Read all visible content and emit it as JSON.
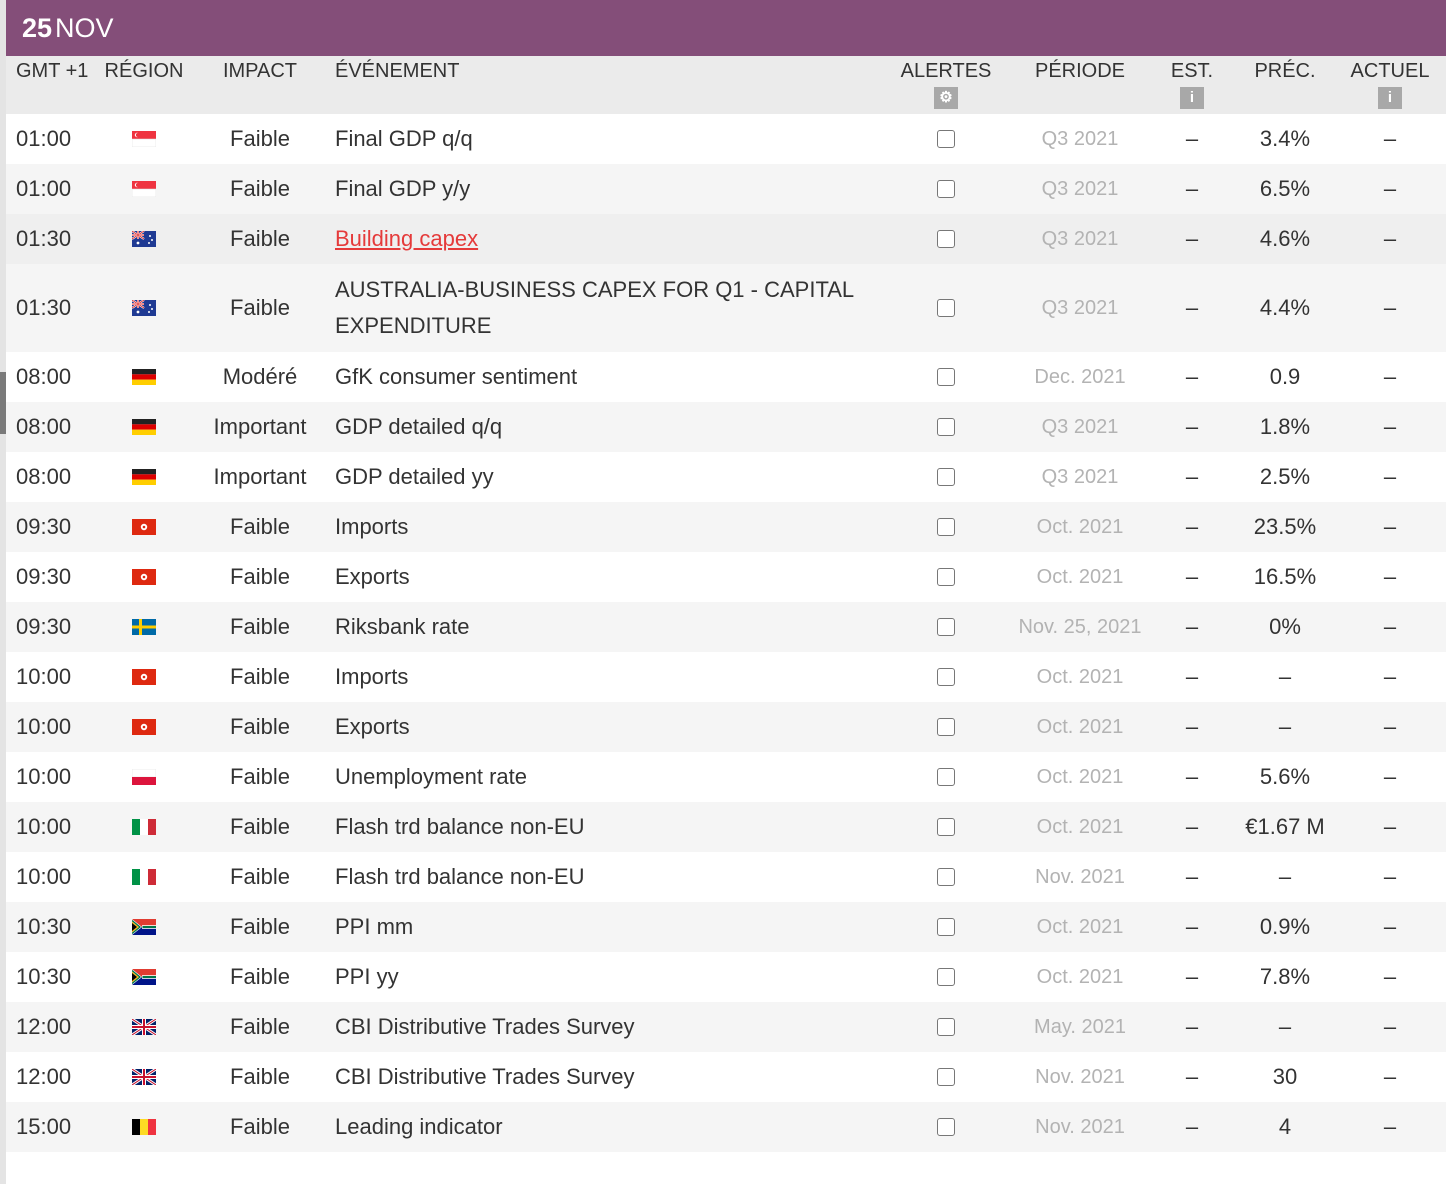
{
  "date": {
    "day": "25",
    "month": "NOV"
  },
  "columns": {
    "gmt": "GMT +1",
    "region": "RÉGION",
    "impact": "IMPACT",
    "event": "ÉVÉNEMENT",
    "alerts": "ALERTES",
    "period": "PÉRIODE",
    "est": "EST.",
    "prec": "PRÉC.",
    "actual": "ACTUEL",
    "alerts_icon": "gear-icon",
    "info_icon": "info-icon"
  },
  "rows": [
    {
      "time": "01:00",
      "flag": "singapore",
      "impact": "Faible",
      "event": "Final GDP q/q",
      "period": "Q3 2021",
      "est": "–",
      "prec": "3.4%",
      "actual": "–"
    },
    {
      "time": "01:00",
      "flag": "singapore",
      "impact": "Faible",
      "event": "Final GDP y/y",
      "period": "Q3 2021",
      "est": "–",
      "prec": "6.5%",
      "actual": "–"
    },
    {
      "time": "01:30",
      "flag": "australia",
      "impact": "Faible",
      "event": "Building capex",
      "period": "Q3 2021",
      "est": "–",
      "prec": "4.6%",
      "actual": "–",
      "link": true,
      "highlight": true
    },
    {
      "time": "01:30",
      "flag": "australia",
      "impact": "Faible",
      "event": "AUSTRALIA-BUSINESS CAPEX FOR Q1 - CAPITAL EXPENDITURE",
      "period": "Q3 2021",
      "est": "–",
      "prec": "4.4%",
      "actual": "–",
      "tall": true
    },
    {
      "time": "08:00",
      "flag": "germany",
      "impact": "Modéré",
      "event": "GfK consumer sentiment",
      "period": "Dec. 2021",
      "est": "–",
      "prec": "0.9",
      "actual": "–"
    },
    {
      "time": "08:00",
      "flag": "germany",
      "impact": "Important",
      "event": "GDP detailed q/q",
      "period": "Q3 2021",
      "est": "–",
      "prec": "1.8%",
      "actual": "–"
    },
    {
      "time": "08:00",
      "flag": "germany",
      "impact": "Important",
      "event": "GDP detailed yy",
      "period": "Q3 2021",
      "est": "–",
      "prec": "2.5%",
      "actual": "–"
    },
    {
      "time": "09:30",
      "flag": "hongkong",
      "impact": "Faible",
      "event": "Imports",
      "period": "Oct. 2021",
      "est": "–",
      "prec": "23.5%",
      "actual": "–"
    },
    {
      "time": "09:30",
      "flag": "hongkong",
      "impact": "Faible",
      "event": "Exports",
      "period": "Oct. 2021",
      "est": "–",
      "prec": "16.5%",
      "actual": "–"
    },
    {
      "time": "09:30",
      "flag": "sweden",
      "impact": "Faible",
      "event": "Riksbank rate",
      "period": "Nov. 25, 2021",
      "est": "–",
      "prec": "0%",
      "actual": "–"
    },
    {
      "time": "10:00",
      "flag": "hongkong",
      "impact": "Faible",
      "event": "Imports",
      "period": "Oct. 2021",
      "est": "–",
      "prec": "–",
      "actual": "–"
    },
    {
      "time": "10:00",
      "flag": "hongkong",
      "impact": "Faible",
      "event": "Exports",
      "period": "Oct. 2021",
      "est": "–",
      "prec": "–",
      "actual": "–"
    },
    {
      "time": "10:00",
      "flag": "poland",
      "impact": "Faible",
      "event": "Unemployment rate",
      "period": "Oct. 2021",
      "est": "–",
      "prec": "5.6%",
      "actual": "–"
    },
    {
      "time": "10:00",
      "flag": "italy",
      "impact": "Faible",
      "event": "Flash trd balance non-EU",
      "period": "Oct. 2021",
      "est": "–",
      "prec": "€1.67 M",
      "actual": "–"
    },
    {
      "time": "10:00",
      "flag": "italy",
      "impact": "Faible",
      "event": "Flash trd balance non-EU",
      "period": "Nov. 2021",
      "est": "–",
      "prec": "–",
      "actual": "–"
    },
    {
      "time": "10:30",
      "flag": "southafrica",
      "impact": "Faible",
      "event": "PPI mm",
      "period": "Oct. 2021",
      "est": "–",
      "prec": "0.9%",
      "actual": "–"
    },
    {
      "time": "10:30",
      "flag": "southafrica",
      "impact": "Faible",
      "event": "PPI yy",
      "period": "Oct. 2021",
      "est": "–",
      "prec": "7.8%",
      "actual": "–"
    },
    {
      "time": "12:00",
      "flag": "uk",
      "impact": "Faible",
      "event": "CBI Distributive Trades Survey",
      "period": "May. 2021",
      "est": "–",
      "prec": "–",
      "actual": "–"
    },
    {
      "time": "12:00",
      "flag": "uk",
      "impact": "Faible",
      "event": "CBI Distributive Trades Survey",
      "period": "Nov. 2021",
      "est": "–",
      "prec": "30",
      "actual": "–"
    },
    {
      "time": "15:00",
      "flag": "belgium",
      "impact": "Faible",
      "event": "Leading indicator",
      "period": "Nov. 2021",
      "est": "–",
      "prec": "4",
      "actual": "–"
    }
  ],
  "colors": {
    "header_bar": "#844e79",
    "link": "#e53a3a",
    "period_text": "#b3b3b3"
  }
}
